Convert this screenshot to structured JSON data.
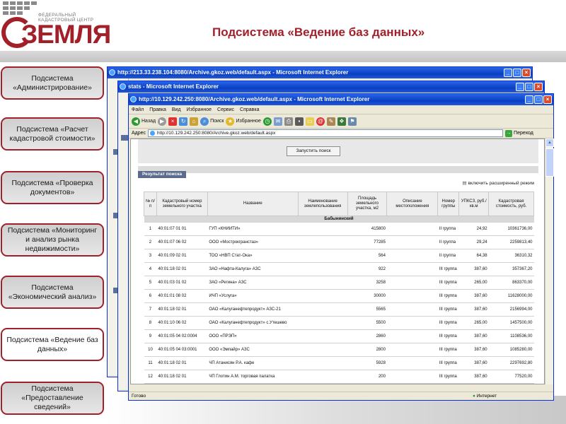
{
  "header": {
    "logo": {
      "org_line1": "ФЕДЕРАЛЬНЫЙ",
      "org_line2": "КАДАСТРОВЫЙ ЦЕНТР",
      "word": "ЗЕМЛЯ"
    },
    "title": "Подсистема «Ведение баз данных»",
    "accent_color": "#a1202a"
  },
  "nav": [
    {
      "label": "Подсистема «Администрирование»",
      "active": false
    },
    {
      "label": "Подсистема «Расчет кадастровой стоимости»",
      "active": false
    },
    {
      "label": "Подсистема «Проверка документов»",
      "active": false
    },
    {
      "label": "Подсистема «Мониторинг и анализ рынка недвижимости»",
      "active": false
    },
    {
      "label": "Подсистема «Экономический анализ»",
      "active": false
    },
    {
      "label": "Подсистема «Ведение баз данных»",
      "active": true
    },
    {
      "label": "Подсистема «Предоставление сведений»",
      "active": false
    }
  ],
  "windows": {
    "back": {
      "title": "http://213.33.238.104:8080/Archive.gkoz.web/default.aspx - Microsoft Internet Explorer"
    },
    "middle": {
      "title": "stats - Microsoft Internet Explorer"
    },
    "front": {
      "title": "http://10.129.242.250:8080/Archive.gkoz.web/default.aspx - Microsoft Internet Explorer",
      "menu": [
        "Файл",
        "Правка",
        "Вид",
        "Избранное",
        "Сервис",
        "Справка"
      ],
      "toolbar": {
        "back": "Назад",
        "search": "Поиск",
        "favorites": "Избранное"
      },
      "address_label": "Адрес",
      "address": "http://10.129.242.250:8080/Archive.gkoz.web/default.aspx",
      "go_label": "Переход",
      "status_left": "Готово",
      "status_right": "Интернет"
    }
  },
  "page": {
    "search_button": "Запустить поиск",
    "result_title": "Результат поиска",
    "extended_mode": "включить расширенный режим",
    "columns": [
      "№ п/п",
      "Кадастровый номер земельного участка",
      "Название",
      "Наименование землепользования",
      "Площадь земельного участка, м2",
      "Описание местоположения",
      "Номер группы",
      "УПКСЗ, руб./кв.м",
      "Кадастровая стоимость, руб."
    ],
    "group": "Бабынинский",
    "rows": [
      {
        "n": "1",
        "cad": "40:01:07 01 01",
        "name": "ГУП «КНИИТИ»",
        "use": "",
        "area": "415800",
        "loc": "",
        "grp": "II группа",
        "upk": "24,92",
        "cost": "10361736,00"
      },
      {
        "n": "2",
        "cad": "40:01:07 06 02",
        "name": "ООО «Мострокгранстаз»",
        "use": "",
        "area": "77285",
        "loc": "",
        "grp": "II группа",
        "upk": "29,24",
        "cost": "2259813,40"
      },
      {
        "n": "3",
        "cad": "40:01:09 02 01",
        "name": "ТОО «НВП Стат-Ока»",
        "use": "",
        "area": "564",
        "loc": "",
        "grp": "II группа",
        "upk": "64,38",
        "cost": "36310,32"
      },
      {
        "n": "4",
        "cad": "40:01:18 02 01",
        "name": "ЗАО «Нафта-Калуга» АЗС",
        "use": "",
        "area": "922",
        "loc": "",
        "grp": "III группа",
        "upk": "387,60",
        "cost": "357367,20"
      },
      {
        "n": "5",
        "cad": "40:01:03 01 02",
        "name": "ЗАО «Регина» АЗС",
        "use": "",
        "area": "3258",
        "loc": "",
        "grp": "III группа",
        "upk": "265,00",
        "cost": "863370,00"
      },
      {
        "n": "6",
        "cad": "40:01:01 08 02",
        "name": "ИЧП «Услуга»",
        "use": "",
        "area": "30000",
        "loc": "",
        "grp": "III группа",
        "upk": "387,60",
        "cost": "11628000,00"
      },
      {
        "n": "7",
        "cad": "40:01:18 02 01",
        "name": "ОАО «Калуганефтепродукт» АЗС-21",
        "use": "",
        "area": "5565",
        "loc": "",
        "grp": "III группа",
        "upk": "387,60",
        "cost": "2156994,00"
      },
      {
        "n": "8",
        "cad": "40:01:10 06 02",
        "name": "ОАО «Калуганефтепродукт» с.Утешево",
        "use": "",
        "area": "5500",
        "loc": "",
        "grp": "III группа",
        "upk": "265,00",
        "cost": "1457500,00"
      },
      {
        "n": "9",
        "cad": "40:01:05 04 02:0004",
        "name": "ООО «ПРЭП»",
        "use": "",
        "area": "2860",
        "loc": "",
        "grp": "III группа",
        "upk": "387,60",
        "cost": "1108536,00"
      },
      {
        "n": "10",
        "cad": "40:01:05 04 03:0001",
        "name": "ООО «Эмпайр» АЗС",
        "use": "",
        "area": "2800",
        "loc": "",
        "grp": "III группа",
        "upk": "387,60",
        "cost": "1085280,00"
      },
      {
        "n": "11",
        "cad": "40:01:18 02 01",
        "name": "ЧП Атанисян Р.А. кафе",
        "use": "",
        "area": "5928",
        "loc": "",
        "grp": "III группа",
        "upk": "387,60",
        "cost": "2297692,80"
      },
      {
        "n": "12",
        "cad": "40:01:18 02 01",
        "name": "ЧП Глотин А.М. торговая палатка",
        "use": "",
        "area": "200",
        "loc": "",
        "grp": "III группа",
        "upk": "387,60",
        "cost": "77520,00"
      }
    ]
  }
}
